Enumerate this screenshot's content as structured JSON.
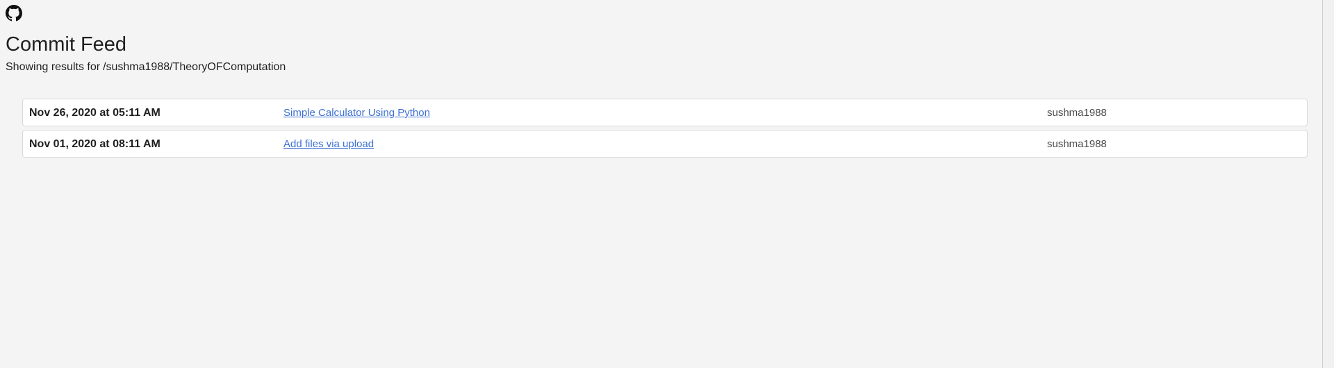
{
  "header": {
    "logo_icon": "github-icon",
    "title": "Commit Feed",
    "subtitle_label": "Showing results for",
    "subtitle_path": "/sushma1988/TheoryOFComputation"
  },
  "commits": [
    {
      "date": "Nov 26, 2020 at 05:11 AM",
      "message": "Simple Calculator Using Python",
      "author": "sushma1988"
    },
    {
      "date": "Nov 01, 2020 at 08:11 AM",
      "message": "Add files via upload",
      "author": "sushma1988"
    }
  ],
  "colors": {
    "background": "#f4f4f4",
    "link": "#3b6fd4",
    "row_border": "#dadada"
  }
}
